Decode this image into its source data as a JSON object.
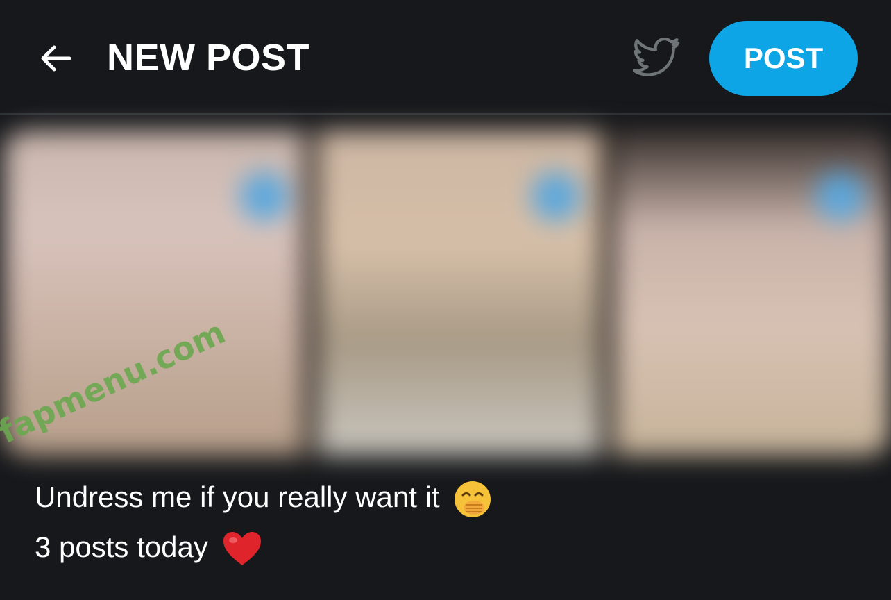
{
  "header": {
    "title": "NEW POST",
    "back_icon": "arrow-left-icon",
    "share_icon": "twitter-bird-icon",
    "post_button_label": "POST"
  },
  "media": {
    "thumbnail_count": 3,
    "blurred": true
  },
  "caption": {
    "line1": "Undress me if you really want it",
    "line1_emoji": "face-with-hand-over-mouth-emoji",
    "line2": "3 posts today",
    "line2_emoji": "red-heart-emoji"
  },
  "watermark": {
    "text": "fapmenu.com"
  },
  "colors": {
    "background": "#16181b",
    "accent": "#0ea5e6",
    "divider": "#2b3034",
    "watermark": "#6aa84f"
  }
}
